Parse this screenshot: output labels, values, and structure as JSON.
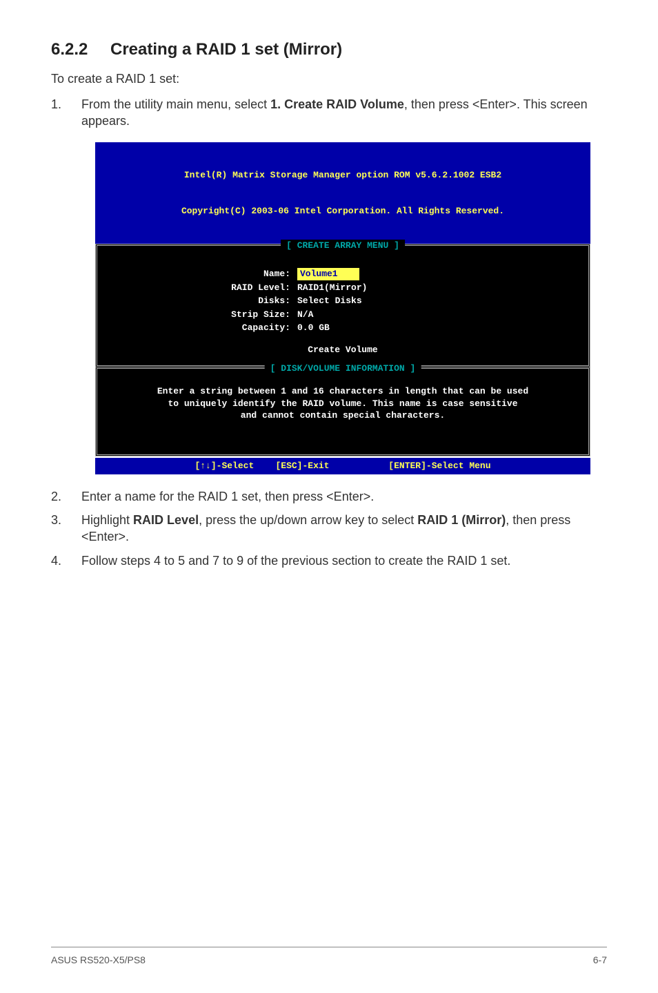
{
  "heading": {
    "number": "6.2.2",
    "title": "Creating a RAID 1 set (Mirror)"
  },
  "intro": "To create a RAID 1 set:",
  "step1": {
    "num": "1.",
    "pre": "From the utility main menu, select ",
    "bold": "1. Create RAID Volume",
    "post": ", then press <Enter>. This screen appears."
  },
  "bios": {
    "header1": "Intel(R) Matrix Storage Manager option ROM v5.6.2.1002 ESB2",
    "header2": "Copyright(C) 2003-06 Intel Corporation. All Rights Reserved.",
    "panel1_title": "[ CREATE ARRAY MENU ]",
    "fields": {
      "name_label": "Name:",
      "name_value": "Volume1",
      "raid_label": "RAID Level:",
      "raid_value": "RAID1(Mirror)",
      "disks_label": "Disks:",
      "disks_value": "Select Disks",
      "strip_label": "Strip Size:",
      "strip_value": "N/A",
      "cap_label": "Capacity:",
      "cap_value": "0.0   GB"
    },
    "create_volume": "Create Volume",
    "panel2_title": "[ DISK/VOLUME INFORMATION ]",
    "help1": "Enter a string between 1 and 16 characters in length that can be used",
    "help2": "to uniquely identify the RAID volume. This name is case sensitive",
    "help3": "and cannot contain special characters.",
    "footer": "[↑↓]-Select    [ESC]-Exit           [ENTER]-Select Menu"
  },
  "step2": {
    "num": "2.",
    "text": "Enter a name for the RAID 1 set, then press <Enter>."
  },
  "step3": {
    "num": "3.",
    "pre": "Highlight ",
    "bold1": "RAID Level",
    "mid": ", press the up/down arrow key to select ",
    "bold2": "RAID 1 (Mirror)",
    "post": ", then press <Enter>."
  },
  "step4": {
    "num": "4.",
    "text": "Follow steps 4 to 5 and 7 to 9 of the previous section to create the RAID 1 set."
  },
  "footer": {
    "left": "ASUS RS520-X5/PS8",
    "right": "6-7"
  }
}
